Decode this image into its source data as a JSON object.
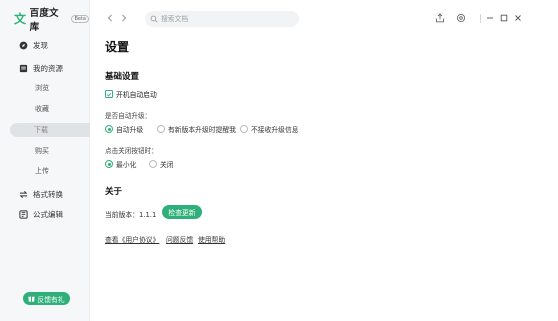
{
  "app": {
    "logo_text": "百度文库",
    "beta": "Beta"
  },
  "sidebar": {
    "items": [
      {
        "label": "发现",
        "icon": "compass-icon"
      },
      {
        "label": "我的资源",
        "icon": "folder-icon"
      },
      {
        "label": "格式转换",
        "icon": "convert-icon"
      },
      {
        "label": "公式编辑",
        "icon": "formula-icon"
      }
    ],
    "sub_items": [
      "浏览",
      "收藏",
      "下载",
      "购买",
      "上传"
    ],
    "active_sub": "下载",
    "feedback_label": "反馈有礼"
  },
  "search": {
    "placeholder": "搜索文档"
  },
  "main": {
    "title": "设置",
    "basic_settings": {
      "title": "基础设置",
      "autostart_label": "开机自动启动",
      "autostart_checked": true,
      "auto_upgrade_label": "是否自动升级：",
      "upgrade_options": [
        "自动升级",
        "有新版本升级时提醒我",
        "不接收升级信息"
      ],
      "upgrade_selected": "自动升级",
      "close_label": "点击关闭按钮时：",
      "close_options": [
        "最小化",
        "关闭"
      ],
      "close_selected": "最小化"
    },
    "about": {
      "title": "关于",
      "version_label": "当前版本：1.1.1",
      "check_update": "检查更新",
      "links": [
        "查看《用户协议》",
        "问题反馈",
        "使用帮助"
      ]
    }
  },
  "colors": {
    "accent": "#2fb07a",
    "sidebar_bg": "#f6f7f8"
  }
}
